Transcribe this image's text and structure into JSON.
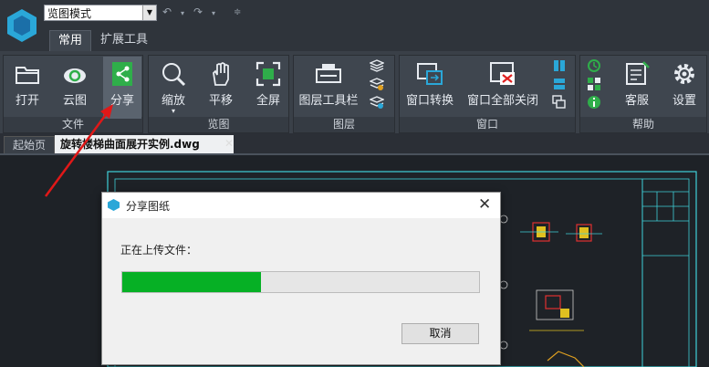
{
  "title_bar": {
    "mode_select_value": "览图模式",
    "quick_access": [
      "undo",
      "redo"
    ]
  },
  "ribbon_tabs": [
    {
      "label": "常用",
      "active": true
    },
    {
      "label": "扩展工具",
      "active": false
    }
  ],
  "ribbon": {
    "groups": [
      {
        "label": "文件",
        "buttons": [
          "打开",
          "云图",
          "分享"
        ]
      },
      {
        "label": "览图",
        "buttons": [
          "缩放",
          "平移",
          "全屏"
        ]
      },
      {
        "label": "图层",
        "buttons": [
          "图层工具栏"
        ]
      },
      {
        "label": "窗口",
        "buttons": [
          "窗口转换",
          "窗口全部关闭"
        ]
      },
      {
        "label": "帮助",
        "buttons": [
          "客服",
          "设置"
        ]
      }
    ],
    "active_button": "分享"
  },
  "doc_tabs": {
    "home": "起始页",
    "file": "旋转楼梯曲面展开实例.dwg"
  },
  "dialog": {
    "title": "分享图纸",
    "message": "正在上传文件：",
    "progress": 0.39,
    "cancel_label": "取消"
  },
  "colors": {
    "accent_green": "#06b025",
    "ribbon_bg": "#3f464f",
    "canvas_bg": "#1e2227",
    "cad_cyan": "#3fd0d8"
  }
}
